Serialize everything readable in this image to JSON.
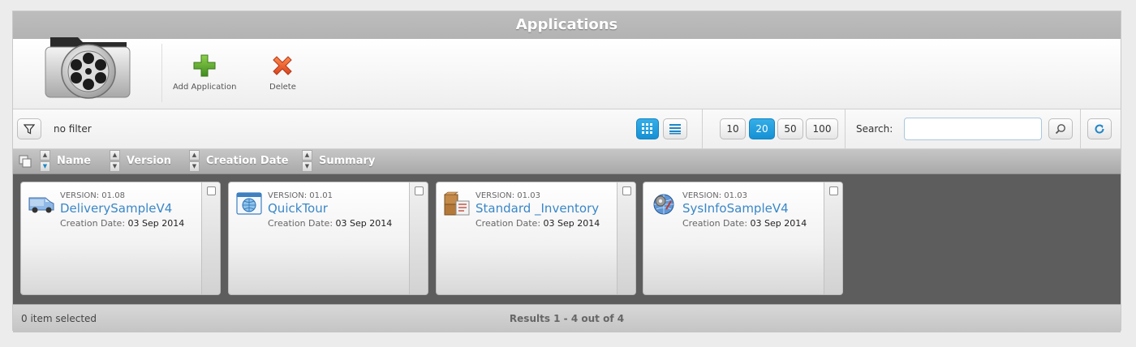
{
  "window": {
    "title": "Applications"
  },
  "app_icon": {
    "name": "film-reel-folder-icon"
  },
  "toolbar": {
    "add_label": "Add Application",
    "add_icon": "plus-icon",
    "delete_label": "Delete",
    "delete_icon": "delete-x-icon"
  },
  "filterbar": {
    "filter_icon": "funnel-icon",
    "filter_text": "no filter",
    "view_modes": [
      "grid-view-icon",
      "list-view-icon"
    ],
    "active_view": "grid",
    "page_sizes": [
      "10",
      "20",
      "50",
      "100"
    ],
    "active_page_size": "20",
    "search_label": "Search:",
    "search_value": "",
    "search_icon": "magnifier-icon",
    "refresh_icon": "refresh-icon"
  },
  "columns": [
    "Name",
    "Version",
    "Creation Date",
    "Summary"
  ],
  "applications": [
    {
      "version_label": "VERSION: 01.08",
      "name": "DeliverySampleV4",
      "date_key": "Creation Date:",
      "date_value": "03 Sep 2014",
      "icon": "delivery-van-icon"
    },
    {
      "version_label": "VERSION: 01.01",
      "name": "QuickTour",
      "date_key": "Creation Date:",
      "date_value": "03 Sep 2014",
      "icon": "globe-window-icon"
    },
    {
      "version_label": "VERSION: 01.03",
      "name": "Standard _Inventory",
      "date_key": "Creation Date:",
      "date_value": "03 Sep 2014",
      "icon": "boxes-inventory-icon"
    },
    {
      "version_label": "VERSION: 01.03",
      "name": "SysInfoSampleV4",
      "date_key": "Creation Date:",
      "date_value": "03 Sep 2014",
      "icon": "globe-gear-icon"
    }
  ],
  "status": {
    "selected": "0 item selected",
    "results": "Results 1 - 4 out of 4"
  },
  "colors": {
    "accent": "#1e9fe0",
    "link": "#3a87c8",
    "content_bg": "#5d5d5d"
  }
}
